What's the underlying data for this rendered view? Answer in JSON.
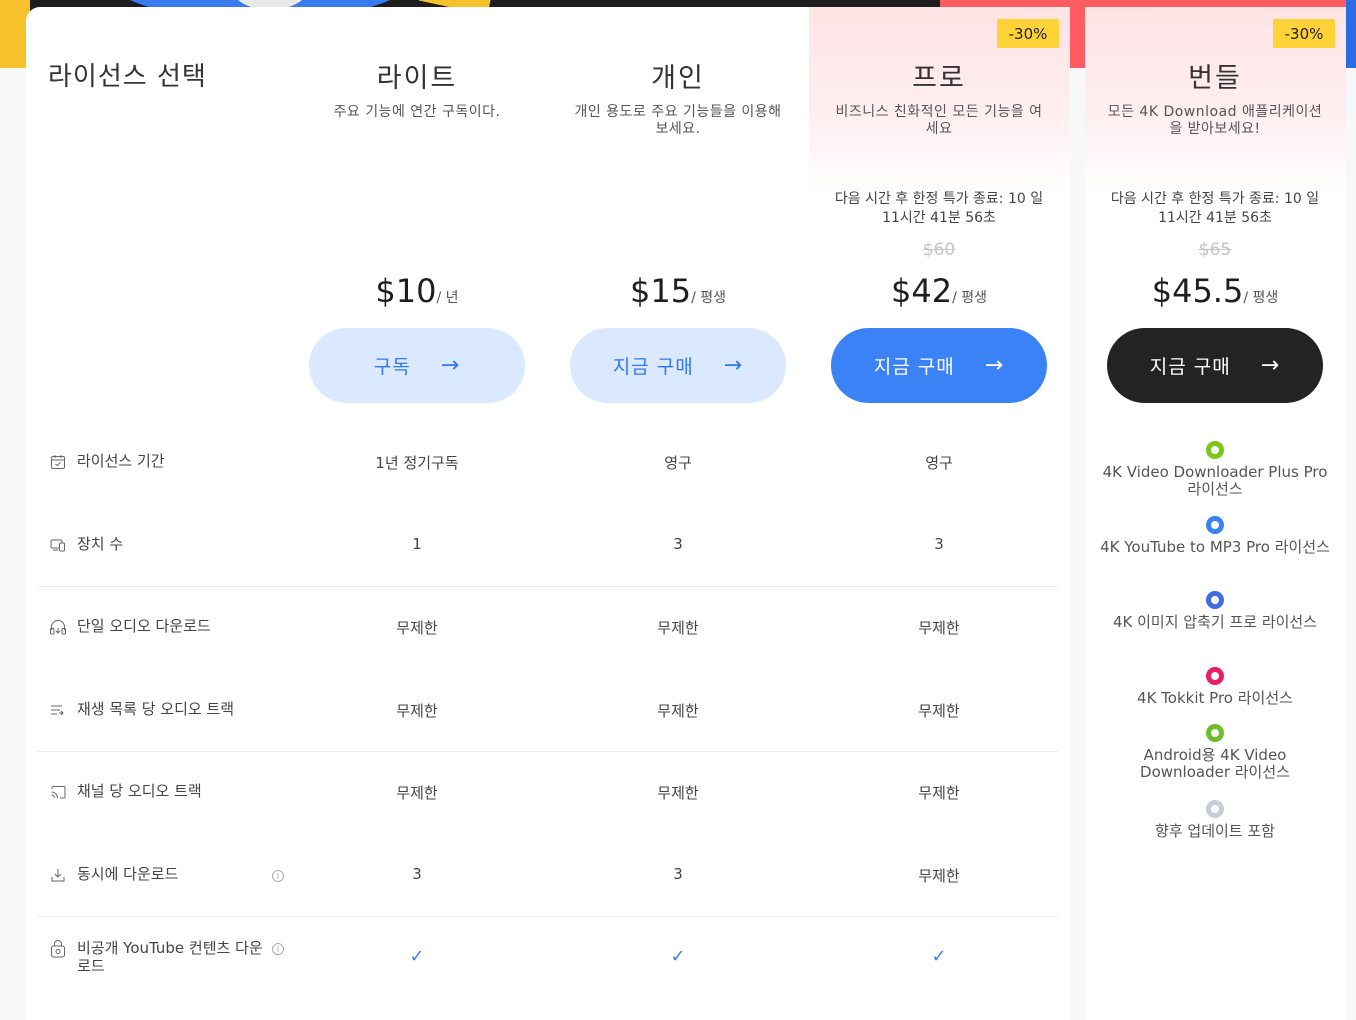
{
  "header": {
    "title": "라이선스 선택"
  },
  "plans": [
    {
      "name": "라이트",
      "desc": "주요 기능에 연간 구독이다.",
      "price": "$10",
      "period": "/ 년",
      "button": "구독"
    },
    {
      "name": "개인",
      "desc": "개인 용도로 주요 기능들을 이용해 보세요.",
      "price": "$15",
      "period": "/ 평생",
      "button": "지금 구매"
    },
    {
      "name": "프로",
      "desc": "비즈니스 친화적인 모든 기능을 여세요",
      "timer": "다음 시간 후 한정 특가 종료: 10 일 11시간 41분 56초",
      "old_price": "$60",
      "price": "$42",
      "period": "/ 평생",
      "button": "지금 구매",
      "badge": "-30%"
    },
    {
      "name": "번들",
      "desc": "모든 4K Download 애플리케이션을 받아보세요!",
      "timer": "다음 시간 후 한정 특가 종료: 10 일 11시간 41분 56초",
      "old_price": "$65",
      "price": "$45.5",
      "period": "/ 평생",
      "button": "지금 구매",
      "badge": "-30%"
    }
  ],
  "features": [
    {
      "label": "라이선스 기간",
      "icon": "calendar-icon",
      "values": [
        "1년 정기구독",
        "영구",
        "영구"
      ]
    },
    {
      "label": "장치 수",
      "icon": "devices-icon",
      "values": [
        "1",
        "3",
        "3"
      ]
    },
    {
      "label": "단일 오디오 다운로드",
      "icon": "headphones-icon",
      "values": [
        "무제한",
        "무제한",
        "무제한"
      ]
    },
    {
      "label": "재생 목록 당 오디오 트랙",
      "icon": "playlist-icon",
      "values": [
        "무제한",
        "무제한",
        "무제한"
      ]
    },
    {
      "label": "채널 당 오디오 트랙",
      "icon": "cast-icon",
      "values": [
        "무제한",
        "무제한",
        "무제한"
      ]
    },
    {
      "label": "동시에 다운로드",
      "icon": "download-icon",
      "values": [
        "3",
        "3",
        "무제한"
      ],
      "info": "i"
    },
    {
      "label": "비공개 YouTube 컨텐츠 다운로드",
      "icon": "lock-icon",
      "values": [
        "✓",
        "✓",
        "✓"
      ],
      "info": "i"
    }
  ],
  "bundle_items": [
    {
      "label": "4K Video Downloader Plus Pro 라이선스",
      "icon": "video-downloader-icon",
      "color": "#7cc61d"
    },
    {
      "label": "4K YouTube to MP3 Pro 라이선스",
      "icon": "youtube-mp3-icon",
      "color": "#3b82f6"
    },
    {
      "label": "4K 이미지 압축기 프로 라이선스",
      "icon": "image-compressor-icon",
      "color": "#3f6de0"
    },
    {
      "label": "4K Tokkit Pro 라이선스",
      "icon": "tokkit-icon",
      "color": "#e91e63"
    },
    {
      "label": "Android용 4K Video Downloader 라이선스",
      "icon": "android-downloader-icon",
      "color": "#6cbf2a"
    },
    {
      "label": "향후 업데이트 포함",
      "icon": "updates-icon",
      "color": "#c7ced8"
    }
  ]
}
